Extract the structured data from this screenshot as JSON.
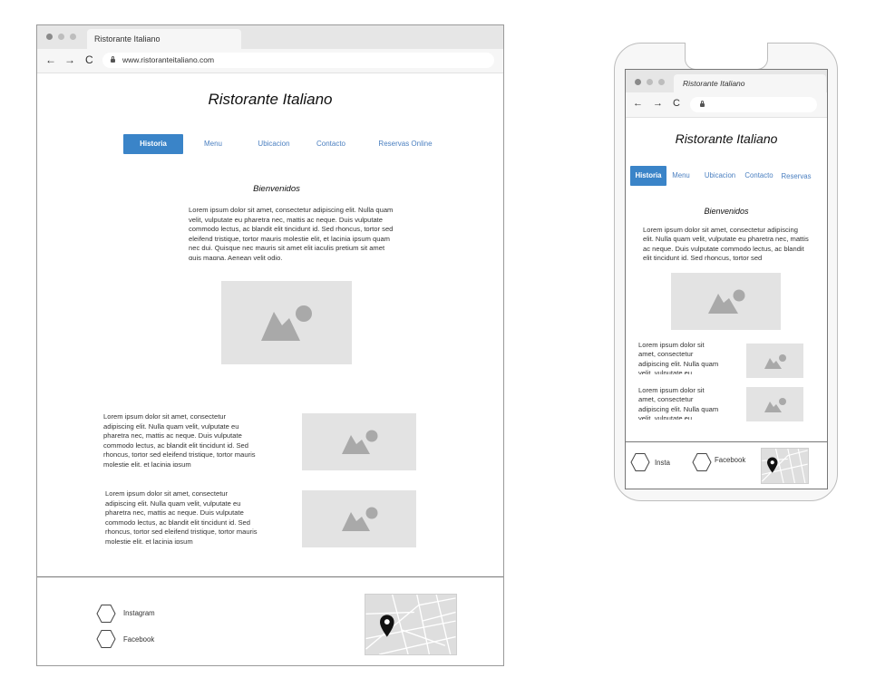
{
  "desktop": {
    "browser": {
      "tab_title": "Ristorante Italiano",
      "url": "www.ristoranteitaliano.com",
      "back_icon": "arrow-left-icon",
      "forward_icon": "arrow-right-icon",
      "reload_icon": "reload-icon"
    },
    "title": "Ristorante Italiano",
    "nav": [
      "Historia",
      "Menu",
      "Ubicacion",
      "Contacto",
      "Reservas Online"
    ],
    "active_nav": "Historia",
    "welcome": "Bienvenidos",
    "intro_text": "Lorem ipsum dolor sit amet, consectetur adipiscing elit. Nulla quam velit, vulputate eu pharetra nec, mattis ac neque. Duis vulputate commodo lectus, ac blandit elit tincidunt id. Sed rhoncus, tortor sed eleifend tristique, tortor mauris molestie elit, et lacinia ipsum quam nec dui. Quisque nec mauris sit amet elit iaculis pretium sit amet quis magna. Aenean velit odio.",
    "block1_text": "Lorem ipsum dolor sit amet, consectetur adipiscing elit. Nulla quam velit, vulputate eu pharetra nec, mattis ac neque. Duis vulputate commodo lectus, ac blandit elit tincidunt id. Sed rhoncus, tortor sed eleifend tristique, tortor mauris molestie elit, et lacinia ipsum",
    "block2_text": "Lorem ipsum dolor sit amet, consectetur adipiscing elit. Nulla quam velit, vulputate eu pharetra nec, mattis ac neque. Duis vulputate commodo lectus, ac blandit elit tincidunt id. Sed rhoncus, tortor sed eleifend tristique, tortor mauris molestie elit, et lacinia ipsum",
    "footer": {
      "instagram": "Instagram",
      "facebook": "Facebook"
    }
  },
  "mobile": {
    "browser": {
      "tab_title": "Ristorante Italiano"
    },
    "title": "Ristorante Italiano",
    "nav": [
      "Historia",
      "Menu",
      "Ubicacion",
      "Contacto",
      "Reservas"
    ],
    "active_nav": "Historia",
    "welcome": "Bienvenidos",
    "intro_text": "Lorem ipsum dolor sit amet, consectetur adipiscing elit. Nulla quam velit, vulputate eu pharetra nec, mattis ac neque. Duis vulputate commodo lectus, ac blandit elit tincidunt id. Sed rhoncus, tortor sed",
    "block1_text": "Lorem ipsum dolor sit amet, consectetur adipiscing elit. Nulla quam velit, vulputate eu",
    "block2_text": "Lorem ipsum dolor sit amet, consectetur adipiscing elit. Nulla quam velit, vulputate eu",
    "footer": {
      "instagram": "Insta",
      "facebook": "Facebook"
    }
  },
  "colors": {
    "accent": "#3a84c8",
    "placeholder": "#e3e3e3",
    "image_glyph": "#a9a9a9"
  },
  "icons": {
    "image": "image-placeholder-icon",
    "map_pin": "map-pin-icon",
    "social": "hexagon-icon",
    "lock": "lock-icon"
  }
}
